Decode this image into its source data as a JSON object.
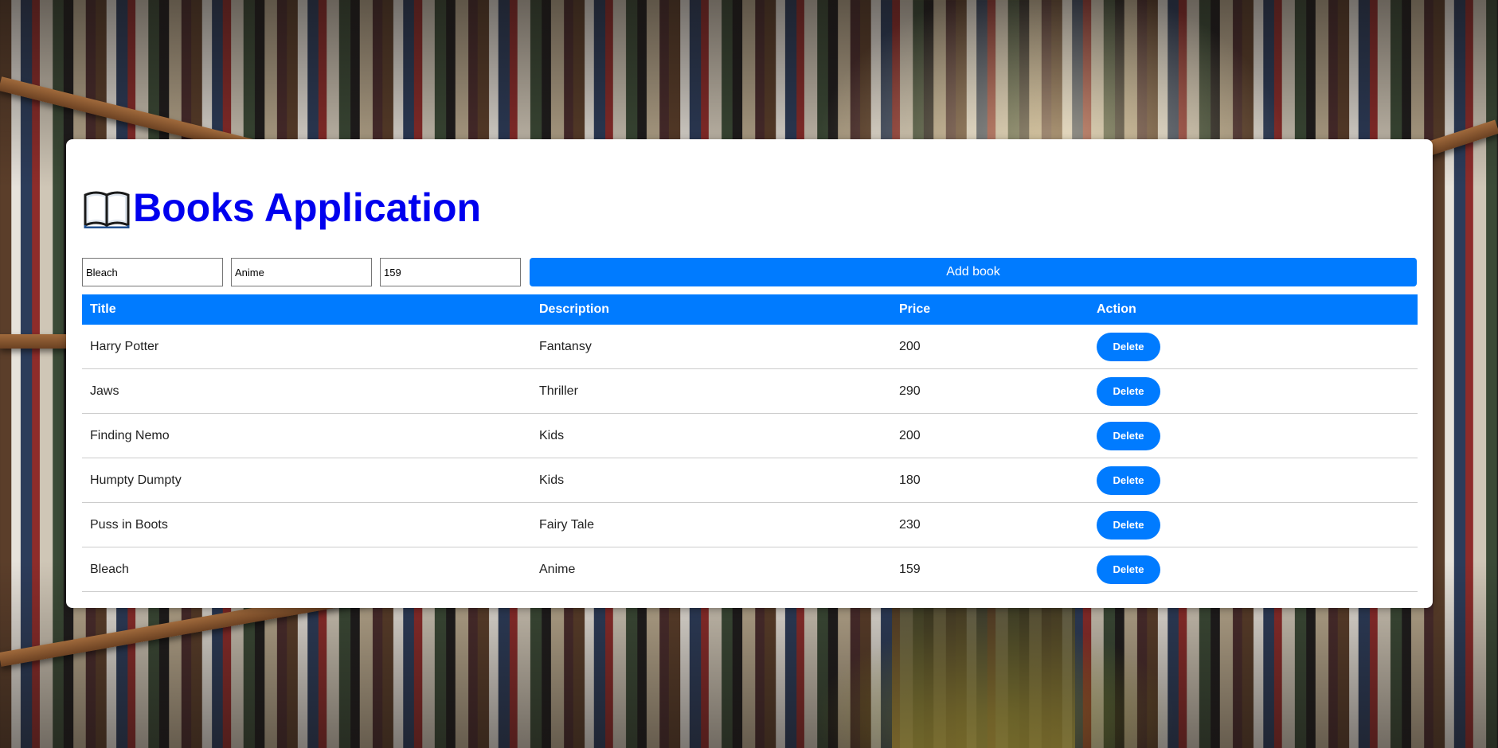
{
  "app": {
    "title": "Books Application",
    "accent_color": "#007bff",
    "title_color": "#0000ee"
  },
  "form": {
    "title_value": "Bleach",
    "description_value": "Anime",
    "price_value": "159",
    "add_button_label": "Add book"
  },
  "table": {
    "headers": {
      "title": "Title",
      "description": "Description",
      "price": "Price",
      "action": "Action"
    },
    "delete_label": "Delete",
    "rows": [
      {
        "title": "Harry Potter",
        "description": "Fantansy",
        "price": "200"
      },
      {
        "title": "Jaws",
        "description": "Thriller",
        "price": "290"
      },
      {
        "title": "Finding Nemo",
        "description": "Kids",
        "price": "200"
      },
      {
        "title": "Humpty Dumpty",
        "description": "Kids",
        "price": "180"
      },
      {
        "title": "Puss in Boots",
        "description": "Fairy Tale",
        "price": "230"
      },
      {
        "title": "Bleach",
        "description": "Anime",
        "price": "159"
      }
    ]
  },
  "icons": {
    "title_icon": "open-book-icon"
  }
}
